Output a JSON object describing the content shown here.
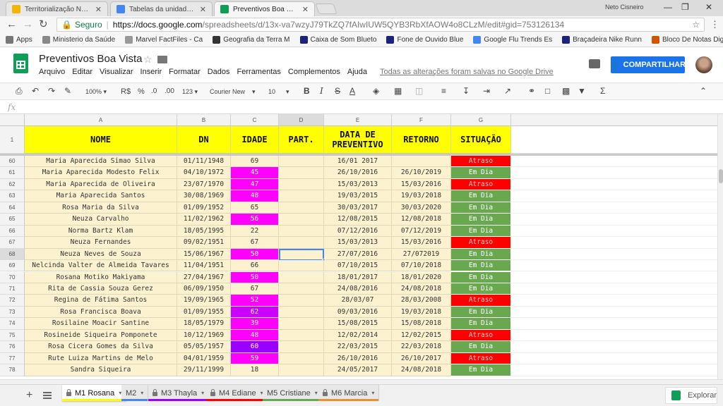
{
  "browser": {
    "tabs": [
      {
        "title": "Territorialização Nova PN",
        "active": false,
        "color": "#f4b400"
      },
      {
        "title": "Tabelas da unidade - Goo",
        "active": false,
        "color": "#4285f4"
      },
      {
        "title": "Preventivos Boa Vista - P",
        "active": true,
        "color": "#0f9d58"
      }
    ],
    "profile_name": "Neto Cisneiro",
    "secure_label": "Seguro",
    "url_host": "https://docs.google.com",
    "url_path": "/spreadsheets/d/13x-va7wzyJ79TkZQ7fAIwIUW5QYB3RbXfAOW4o8CLzM/edit#gid=753126134",
    "bookmarks": [
      {
        "label": "Apps",
        "icon": "apps-grid-icon",
        "color": "#777777"
      },
      {
        "label": "Ministerio da Saúde",
        "icon": "globe-icon",
        "color": "#888888"
      },
      {
        "label": "Marvel FactFiles - Ca",
        "icon": "page-icon",
        "color": "#999999"
      },
      {
        "label": "Geografia da Terra M",
        "icon": "wikipedia-icon",
        "color": "#333333"
      },
      {
        "label": "Caixa de Som Blueto",
        "icon": "s-icon",
        "color": "#1a237e"
      },
      {
        "label": "Fone de Ouvido Blue",
        "icon": "s-icon",
        "color": "#1a237e"
      },
      {
        "label": "Google Flu Trends Es",
        "icon": "google-icon",
        "color": "#4285f4"
      },
      {
        "label": "Braçadeira Nike Runn",
        "icon": "s-icon",
        "color": "#1a237e"
      },
      {
        "label": "Bloco De Notas Digit",
        "icon": "notebook-icon",
        "color": "#d35400"
      }
    ]
  },
  "sheets": {
    "doc_title": "Preventivos Boa Vista",
    "menu": [
      "Arquivo",
      "Editar",
      "Visualizar",
      "Inserir",
      "Formatar",
      "Dados",
      "Ferramentas",
      "Complementos",
      "Ajuda"
    ],
    "saved_status": "Todas as alterações foram salvas no Google Drive",
    "share_label": "COMPARTILHAR",
    "toolbar": {
      "zoom": "100%",
      "currency": "R$",
      "percent": "%",
      "dec_less": ".0",
      "dec_more": ".00",
      "format_more": "123",
      "font": "Courier New",
      "font_size": "10"
    },
    "fx_label": "fx",
    "column_letters": [
      "A",
      "B",
      "C",
      "D",
      "E",
      "F",
      "G"
    ],
    "header_row_number": "1",
    "headers": [
      "NOME",
      "DN",
      "IDADE",
      "PART.",
      "DATA DE\nPREVENTIVO",
      "RETORNO",
      "SITUAÇÃO"
    ],
    "rows": [
      {
        "n": "60",
        "nome": "Maria Aparecida Simao Silva",
        "dn": "01/11/1948",
        "idade": "69",
        "part": "",
        "prev": "16/01 2017",
        "ret": "",
        "sit": "Atraso"
      },
      {
        "n": "61",
        "nome": "Maria Aparecida Modesto Felix",
        "dn": "04/10/1972",
        "idade": "45",
        "part": "",
        "prev": "26/10/2016",
        "ret": "26/10/2019",
        "sit": "Em Dia"
      },
      {
        "n": "62",
        "nome": "Maria Aparecida de Oliveira",
        "dn": "23/07/1970",
        "idade": "47",
        "part": "",
        "prev": "15/03/2013",
        "ret": "15/03/2016",
        "sit": "Atraso"
      },
      {
        "n": "63",
        "nome": "Maria Aparecida Santos",
        "dn": "30/08/1969",
        "idade": "48",
        "part": "",
        "prev": "19/03/2015",
        "ret": "19/03/2018",
        "sit": "Em Dia"
      },
      {
        "n": "64",
        "nome": "Rosa Maria da Silva",
        "dn": "01/09/1952",
        "idade": "65",
        "part": "",
        "prev": "30/03/2017",
        "ret": "30/03/2020",
        "sit": "Em Dia"
      },
      {
        "n": "65",
        "nome": "Neuza Carvalho",
        "dn": "11/02/1962",
        "idade": "56",
        "part": "",
        "prev": "12/08/2015",
        "ret": "12/08/2018",
        "sit": "Em Dia"
      },
      {
        "n": "66",
        "nome": "Norma Bartz Klam",
        "dn": "18/05/1995",
        "idade": "22",
        "part": "",
        "prev": "07/12/2016",
        "ret": "07/12/2019",
        "sit": "Em Dia"
      },
      {
        "n": "67",
        "nome": "Neuza Fernandes",
        "dn": "09/02/1951",
        "idade": "67",
        "part": "",
        "prev": "15/03/2013",
        "ret": "15/03/2016",
        "sit": "Atraso"
      },
      {
        "n": "68",
        "nome": "Neuza Neves de Souza",
        "dn": "15/06/1967",
        "idade": "50",
        "part": "",
        "prev": "27/07/2016",
        "ret": "27/072019",
        "sit": "Em Dia"
      },
      {
        "n": "69",
        "nome": "Nelcinda Valter de Almeida Tavares",
        "dn": "11/04/1951",
        "idade": "66",
        "part": "",
        "prev": "07/10/2015",
        "ret": "07/10/2018",
        "sit": "Em Dia"
      },
      {
        "n": "70",
        "nome": "Rosana Motiko Makiyama",
        "dn": "27/04/1967",
        "idade": "50",
        "part": "",
        "prev": "18/01/2017",
        "ret": "18/01/2020",
        "sit": "Em Dia"
      },
      {
        "n": "71",
        "nome": "Rita de Cassia Souza Gerez",
        "dn": "06/09/1950",
        "idade": "67",
        "part": "",
        "prev": "24/08/2016",
        "ret": "24/08/2018",
        "sit": "Em Dia"
      },
      {
        "n": "72",
        "nome": "Regina de Fátima Santos",
        "dn": "19/09/1965",
        "idade": "52",
        "part": "",
        "prev": "28/03/07",
        "ret": "28/03/2008",
        "sit": "Atraso"
      },
      {
        "n": "73",
        "nome": "Rosa Francisca Boava",
        "dn": "01/09/1955",
        "idade": "62",
        "part": "",
        "prev": "09/03/2016",
        "ret": "19/03/2018",
        "sit": "Em Dia"
      },
      {
        "n": "74",
        "nome": "Rosilaine Moacir Santine",
        "dn": "18/05/1979",
        "idade": "39",
        "part": "",
        "prev": "15/08/2015",
        "ret": "15/08/2018",
        "sit": "Em Dia"
      },
      {
        "n": "75",
        "nome": "Rosineide Siqueira Pomponete",
        "dn": "10/12/1969",
        "idade": "48",
        "part": "",
        "prev": "12/02/2014",
        "ret": "12/02/2015",
        "sit": "Atraso"
      },
      {
        "n": "76",
        "nome": "Rosa Cicera Gomes da Silva",
        "dn": "05/05/1957",
        "idade": "60",
        "part": "",
        "prev": "22/03/2015",
        "ret": "22/03/2018",
        "sit": "Em Dia"
      },
      {
        "n": "77",
        "nome": "Rute Luiza Martins de Melo",
        "dn": "04/01/1959",
        "idade": "59",
        "part": "",
        "prev": "26/10/2016",
        "ret": "26/10/2017",
        "sit": "Atraso"
      },
      {
        "n": "78",
        "nome": "Sandra Siqueira",
        "dn": "29/11/1999",
        "idade": "18",
        "part": "",
        "prev": "24/05/2017",
        "ret": "24/08/2018",
        "sit": "Em Dia"
      }
    ],
    "idade_highlight": {
      "45": "#ff00ff",
      "47": "#ff00ff",
      "48": "#ff00ff",
      "56": "#ff00ff",
      "50": "#ff00ff",
      "52": "#ff00ff",
      "62": "#cc00ff",
      "39": "#ff00ff",
      "60": "#9900ff",
      "59": "#ff00ff"
    },
    "status_colors": {
      "Atraso": "#ff0000",
      "Em Dia": "#6aa84f"
    },
    "selected_cell": "D68",
    "sheet_tabs": [
      {
        "label": "M1 Rosana",
        "locked": true,
        "active": true,
        "color": "#ffff00"
      },
      {
        "label": "M2",
        "locked": false,
        "active": false,
        "color": "#4a86e8"
      },
      {
        "label": "M3 Thayla",
        "locked": true,
        "active": false,
        "color": "#9900ff"
      },
      {
        "label": "M4 Ediane",
        "locked": true,
        "active": false,
        "color": "#ff0000"
      },
      {
        "label": "M5 Cristiane",
        "locked": false,
        "active": false,
        "color": "#6aa84f"
      },
      {
        "label": "M6 Marcia",
        "locked": true,
        "active": false,
        "color": "#e69138"
      }
    ],
    "explore_label": "Explorar"
  }
}
